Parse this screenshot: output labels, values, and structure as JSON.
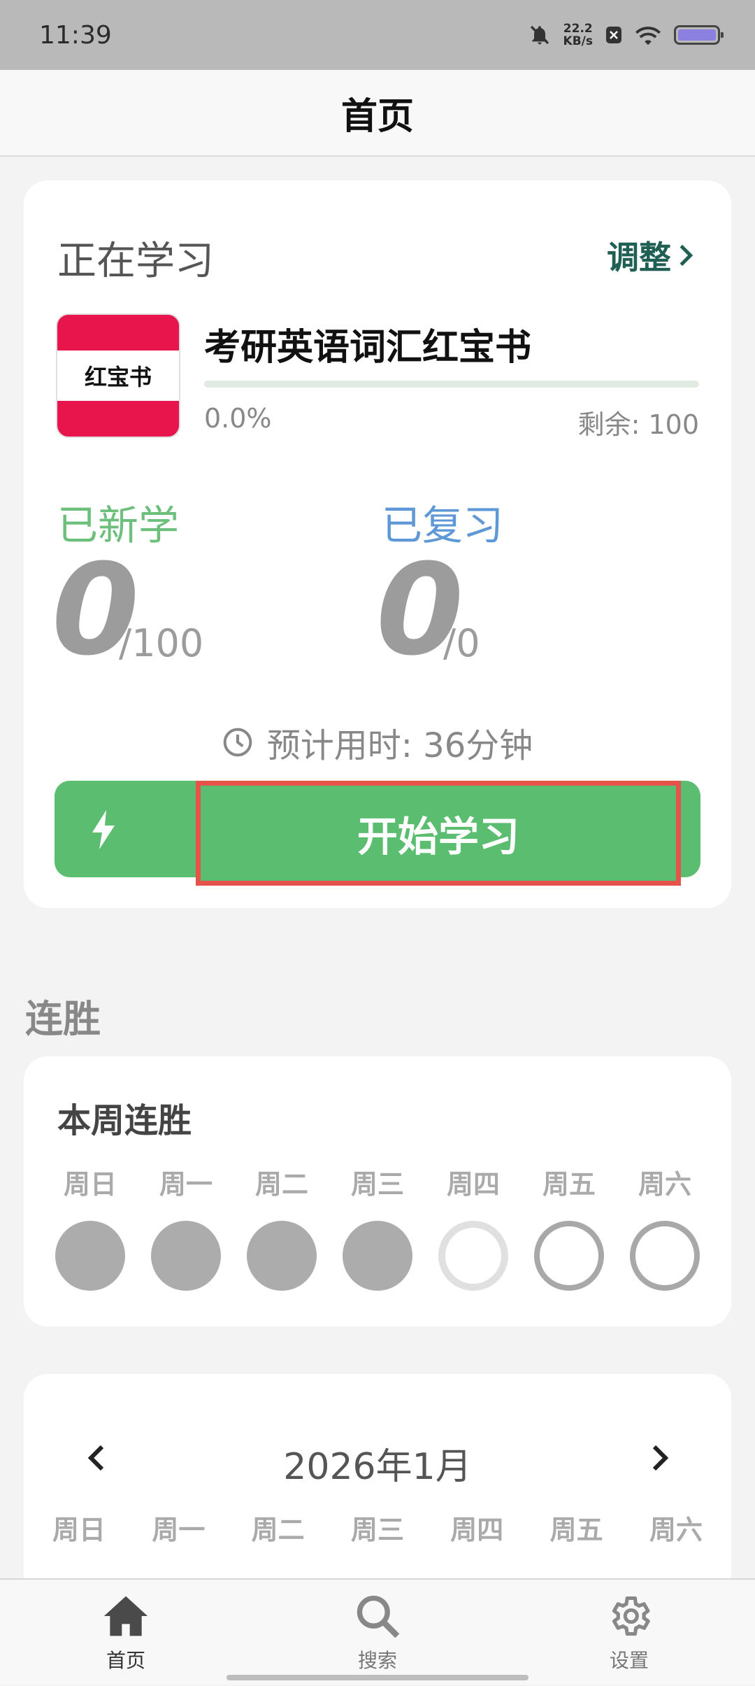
{
  "status_bar": {
    "time": "11:39",
    "net_speed_value": "22.2",
    "net_speed_unit": "KB/s",
    "icons": [
      "bell-off-icon",
      "close-box-icon",
      "wifi-icon",
      "battery-icon"
    ]
  },
  "app_bar": {
    "title": "首页"
  },
  "study_card": {
    "label": "正在学习",
    "adjust_label": "调整",
    "book_cover_text": "红宝书",
    "book_title": "考研英语词汇红宝书",
    "progress_percent_text": "0.0%",
    "progress_fraction": 0.0,
    "remaining_text": "剩余: 100",
    "new_learned_label": "已新学",
    "new_learned_count": "0",
    "new_learned_total": "/100",
    "reviewed_label": "已复习",
    "reviewed_count": "0",
    "reviewed_total": "/0",
    "estimated_time": "预计用时: 36分钟",
    "start_button_label": "开始学习"
  },
  "streak": {
    "heading": "连胜",
    "week_title": "本周连胜",
    "days": [
      {
        "label": "周日",
        "state": "filled"
      },
      {
        "label": "周一",
        "state": "filled"
      },
      {
        "label": "周二",
        "state": "filled"
      },
      {
        "label": "周三",
        "state": "filled"
      },
      {
        "label": "周四",
        "state": "today"
      },
      {
        "label": "周五",
        "state": "future"
      },
      {
        "label": "周六",
        "state": "future"
      }
    ]
  },
  "calendar": {
    "month": "2026年1月",
    "weekdays": [
      "周日",
      "周一",
      "周二",
      "周三",
      "周四",
      "周五",
      "周六"
    ]
  },
  "bottom_nav": {
    "items": [
      {
        "label": "首页",
        "icon": "home-icon",
        "active": true
      },
      {
        "label": "搜索",
        "icon": "search-icon",
        "active": false
      },
      {
        "label": "设置",
        "icon": "gear-icon",
        "active": false
      }
    ]
  },
  "colors": {
    "accent_green": "#5abd6f",
    "review_blue": "#5f98d6",
    "highlight_red": "#e5534b",
    "book_red": "#e8154c"
  }
}
